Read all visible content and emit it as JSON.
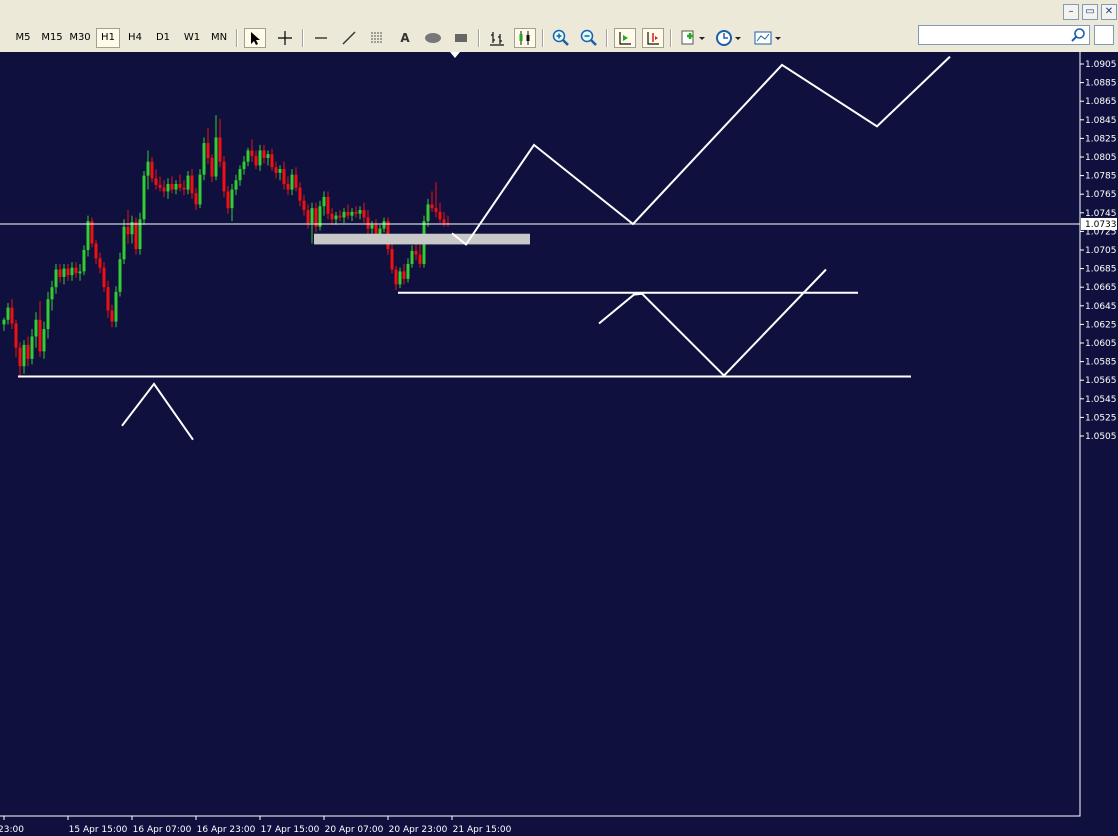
{
  "window": {
    "minimize_label": "–",
    "restore_label": "▭",
    "close_label": "✕"
  },
  "toolbar": {
    "timeframes": [
      {
        "label": "M5",
        "active": false
      },
      {
        "label": "M15",
        "active": false
      },
      {
        "label": "M30",
        "active": false
      },
      {
        "label": "H1",
        "active": true
      },
      {
        "label": "H4",
        "active": false
      },
      {
        "label": "D1",
        "active": false
      },
      {
        "label": "W1",
        "active": false
      },
      {
        "label": "MN",
        "active": false
      }
    ],
    "text_tool_label": "A",
    "search_value": "",
    "icons": [
      "cursor-icon",
      "crosshair-icon",
      "horizontal-line-icon",
      "trendline-icon",
      "fibonacci-icon",
      "text-icon",
      "ellipse-icon",
      "rectangle-icon",
      "bar-chart-icon",
      "candlestick-icon",
      "zoom-in-icon",
      "zoom-out-icon",
      "autoscroll-icon",
      "chart-shift-icon",
      "new-chart-icon",
      "periods-icon",
      "templates-icon",
      "search-icon"
    ]
  },
  "colors": {
    "background": "#10103f",
    "bull": "#33cc33",
    "bear": "#ee1111",
    "drawing": "#ffffff",
    "zone": "#c8c8c8"
  },
  "chart_data": {
    "type": "candlestick",
    "title": "",
    "current_price": "1.0733",
    "y_ticks": [
      "1.0905",
      "1.0885",
      "1.0865",
      "1.0845",
      "1.0825",
      "1.0805",
      "1.0785",
      "1.0765",
      "1.0745",
      "1.0725",
      "1.0705",
      "1.0685",
      "1.0665",
      "1.0645",
      "1.0625",
      "1.0605",
      "1.0585",
      "1.0565",
      "1.0545",
      "1.0525",
      "1.0505"
    ],
    "y_tick_values": [
      1.0905,
      1.0885,
      1.0865,
      1.0845,
      1.0825,
      1.0805,
      1.0785,
      1.0765,
      1.0745,
      1.0725,
      1.0705,
      1.0685,
      1.0665,
      1.0645,
      1.0625,
      1.0605,
      1.0585,
      1.0565,
      1.0545,
      1.0525,
      1.0505
    ],
    "ylim": [
      1.05,
      1.091
    ],
    "x_labels": [
      "23:00",
      "15 Apr 15:00",
      "16 Apr 07:00",
      "16 Apr 23:00",
      "17 Apr 15:00",
      "20 Apr 07:00",
      "20 Apr 23:00",
      "21 Apr 15:00"
    ],
    "x_label_index": [
      0,
      16,
      32,
      48,
      64,
      80,
      96,
      112
    ],
    "candles": [
      [
        1.0625,
        1.0632,
        1.0618,
        1.063
      ],
      [
        1.063,
        1.0648,
        1.0625,
        1.0643
      ],
      [
        1.0643,
        1.0652,
        1.062,
        1.0626
      ],
      [
        1.0626,
        1.063,
        1.059,
        1.06
      ],
      [
        1.06,
        1.0606,
        1.0568,
        1.058
      ],
      [
        1.058,
        1.0608,
        1.0572,
        1.0603
      ],
      [
        1.0603,
        1.0612,
        1.058,
        1.0588
      ],
      [
        1.0588,
        1.062,
        1.0582,
        1.0612
      ],
      [
        1.0612,
        1.0638,
        1.06,
        1.063
      ],
      [
        1.063,
        1.065,
        1.059,
        1.0596
      ],
      [
        1.0596,
        1.0628,
        1.0588,
        1.062
      ],
      [
        1.062,
        1.066,
        1.061,
        1.0652
      ],
      [
        1.0652,
        1.0672,
        1.064,
        1.0665
      ],
      [
        1.0665,
        1.069,
        1.0658,
        1.0684
      ],
      [
        1.0684,
        1.069,
        1.067,
        1.0676
      ],
      [
        1.0676,
        1.069,
        1.0668,
        1.0685
      ],
      [
        1.0685,
        1.069,
        1.0672,
        1.0678
      ],
      [
        1.0678,
        1.0692,
        1.0672,
        1.0686
      ],
      [
        1.0686,
        1.0692,
        1.0675,
        1.068
      ],
      [
        1.068,
        1.069,
        1.0672,
        1.0682
      ],
      [
        1.0682,
        1.071,
        1.0678,
        1.0705
      ],
      [
        1.0705,
        1.0742,
        1.0698,
        1.0736
      ],
      [
        1.0736,
        1.074,
        1.0708,
        1.0712
      ],
      [
        1.0712,
        1.0716,
        1.069,
        1.0696
      ],
      [
        1.0696,
        1.0702,
        1.068,
        1.0686
      ],
      [
        1.0686,
        1.0692,
        1.066,
        1.0665
      ],
      [
        1.0665,
        1.0672,
        1.0632,
        1.064
      ],
      [
        1.064,
        1.0646,
        1.0622,
        1.0628
      ],
      [
        1.0628,
        1.0666,
        1.0622,
        1.066
      ],
      [
        1.066,
        1.0702,
        1.0655,
        1.0695
      ],
      [
        1.0695,
        1.0738,
        1.069,
        1.073
      ],
      [
        1.073,
        1.0748,
        1.0712,
        1.0722
      ],
      [
        1.0722,
        1.0742,
        1.0712,
        1.0735
      ],
      [
        1.0735,
        1.074,
        1.07,
        1.0706
      ],
      [
        1.0706,
        1.0745,
        1.07,
        1.0738
      ],
      [
        1.0738,
        1.079,
        1.0732,
        1.0785
      ],
      [
        1.0785,
        1.0812,
        1.077,
        1.08
      ],
      [
        1.08,
        1.0805,
        1.0778,
        1.0782
      ],
      [
        1.0782,
        1.0792,
        1.077,
        1.0775
      ],
      [
        1.0775,
        1.0784,
        1.0768,
        1.0772
      ],
      [
        1.0772,
        1.078,
        1.0762,
        1.0768
      ],
      [
        1.0768,
        1.0782,
        1.076,
        1.0776
      ],
      [
        1.0776,
        1.0784,
        1.0766,
        1.077
      ],
      [
        1.077,
        1.078,
        1.0765,
        1.0776
      ],
      [
        1.0776,
        1.0786,
        1.0768,
        1.0772
      ],
      [
        1.0772,
        1.078,
        1.0764,
        1.077
      ],
      [
        1.077,
        1.079,
        1.0765,
        1.0785
      ],
      [
        1.0785,
        1.0792,
        1.076,
        1.0766
      ],
      [
        1.0766,
        1.0772,
        1.0748,
        1.0754
      ],
      [
        1.0754,
        1.0792,
        1.075,
        1.0786
      ],
      [
        1.0786,
        1.0826,
        1.078,
        1.082
      ],
      [
        1.082,
        1.0836,
        1.0798,
        1.0804
      ],
      [
        1.0804,
        1.0808,
        1.0778,
        1.0784
      ],
      [
        1.0784,
        1.085,
        1.078,
        1.0826
      ],
      [
        1.0826,
        1.0846,
        1.0794,
        1.08
      ],
      [
        1.08,
        1.0806,
        1.0762,
        1.0768
      ],
      [
        1.0768,
        1.0774,
        1.0744,
        1.075
      ],
      [
        1.075,
        1.0776,
        1.0736,
        1.077
      ],
      [
        1.077,
        1.0786,
        1.0764,
        1.078
      ],
      [
        1.078,
        1.0796,
        1.0774,
        1.0792
      ],
      [
        1.0792,
        1.0806,
        1.0786,
        1.08
      ],
      [
        1.08,
        1.0815,
        1.0795,
        1.0812
      ],
      [
        1.0812,
        1.0824,
        1.08,
        1.0806
      ],
      [
        1.0806,
        1.0812,
        1.0792,
        1.0796
      ],
      [
        1.0796,
        1.0818,
        1.079,
        1.0812
      ],
      [
        1.0812,
        1.0818,
        1.0798,
        1.0804
      ],
      [
        1.0804,
        1.0812,
        1.0796,
        1.0808
      ],
      [
        1.0808,
        1.0814,
        1.079,
        1.0794
      ],
      [
        1.0794,
        1.08,
        1.0782,
        1.0788
      ],
      [
        1.0788,
        1.0796,
        1.078,
        1.0792
      ],
      [
        1.0792,
        1.08,
        1.077,
        1.0776
      ],
      [
        1.0776,
        1.0784,
        1.0764,
        1.077
      ],
      [
        1.077,
        1.0792,
        1.0764,
        1.0786
      ],
      [
        1.0786,
        1.0794,
        1.0768,
        1.0772
      ],
      [
        1.0772,
        1.0778,
        1.0752,
        1.0758
      ],
      [
        1.0758,
        1.0764,
        1.0742,
        1.0748
      ],
      [
        1.0748,
        1.0754,
        1.0728,
        1.0734
      ],
      [
        1.0734,
        1.0756,
        1.0712,
        1.075
      ],
      [
        1.075,
        1.0756,
        1.0724,
        1.073
      ],
      [
        1.073,
        1.0758,
        1.0726,
        1.0752
      ],
      [
        1.0752,
        1.0768,
        1.0742,
        1.0762
      ],
      [
        1.0762,
        1.0768,
        1.0738,
        1.0744
      ],
      [
        1.0744,
        1.075,
        1.0732,
        1.0738
      ],
      [
        1.0738,
        1.0746,
        1.0732,
        1.0742
      ],
      [
        1.0742,
        1.0748,
        1.0736,
        1.074
      ],
      [
        1.074,
        1.075,
        1.0734,
        1.0746
      ],
      [
        1.0746,
        1.0754,
        1.0738,
        1.0742
      ],
      [
        1.0742,
        1.075,
        1.0736,
        1.0746
      ],
      [
        1.0746,
        1.0752,
        1.074,
        1.0744
      ],
      [
        1.0744,
        1.0752,
        1.0738,
        1.0748
      ],
      [
        1.0748,
        1.0756,
        1.0734,
        1.074
      ],
      [
        1.074,
        1.0748,
        1.0722,
        1.0728
      ],
      [
        1.0728,
        1.0736,
        1.072,
        1.0732
      ],
      [
        1.0732,
        1.0738,
        1.0718,
        1.0722
      ],
      [
        1.0722,
        1.0732,
        1.0716,
        1.0728
      ],
      [
        1.0728,
        1.074,
        1.0724,
        1.0736
      ],
      [
        1.0736,
        1.074,
        1.07,
        1.0706
      ],
      [
        1.0706,
        1.0712,
        1.068,
        1.0684
      ],
      [
        1.0684,
        1.0688,
        1.0662,
        1.0668
      ],
      [
        1.0668,
        1.0686,
        1.0664,
        1.0682
      ],
      [
        1.0682,
        1.069,
        1.0668,
        1.0674
      ],
      [
        1.0674,
        1.0696,
        1.067,
        1.069
      ],
      [
        1.069,
        1.071,
        1.0686,
        1.0704
      ],
      [
        1.0704,
        1.0716,
        1.0694,
        1.07
      ],
      [
        1.07,
        1.0714,
        1.0686,
        1.069
      ],
      [
        1.069,
        1.0742,
        1.0686,
        1.0736
      ],
      [
        1.0736,
        1.076,
        1.073,
        1.0754
      ],
      [
        1.0754,
        1.0768,
        1.0746,
        1.075
      ],
      [
        1.075,
        1.0778,
        1.074,
        1.0746
      ],
      [
        1.0746,
        1.0756,
        1.0734,
        1.0738
      ],
      [
        1.0738,
        1.0746,
        1.073,
        1.0734
      ],
      [
        1.0734,
        1.0742,
        1.073,
        1.0733
      ]
    ],
    "drawings": {
      "zone": {
        "x_from": 314,
        "x_to": 530,
        "price_top": 1.07225,
        "price_bottom": 1.0711
      },
      "h_lines": [
        {
          "x_from": 0,
          "x_to": 1080,
          "price": 1.0733
        },
        {
          "x_from": 398,
          "x_to": 858,
          "price": 1.0659
        },
        {
          "x_from": 18,
          "x_to": 911,
          "price": 1.0569
        }
      ],
      "polylines": [
        [
          [
            452,
            1.0723
          ],
          [
            466,
            1.0711
          ],
          [
            534,
            1.0818
          ],
          [
            633,
            1.0733
          ],
          [
            782,
            1.0904
          ],
          [
            877,
            1.0838
          ],
          [
            950,
            1.0913
          ]
        ],
        [
          [
            599,
            1.0626
          ],
          [
            634,
            1.0657
          ],
          [
            642,
            1.0658
          ],
          [
            724,
            1.057
          ],
          [
            826,
            1.0684
          ]
        ],
        [
          [
            122,
            1.0516
          ],
          [
            154,
            1.0561
          ],
          [
            193,
            1.0501
          ]
        ]
      ]
    }
  }
}
